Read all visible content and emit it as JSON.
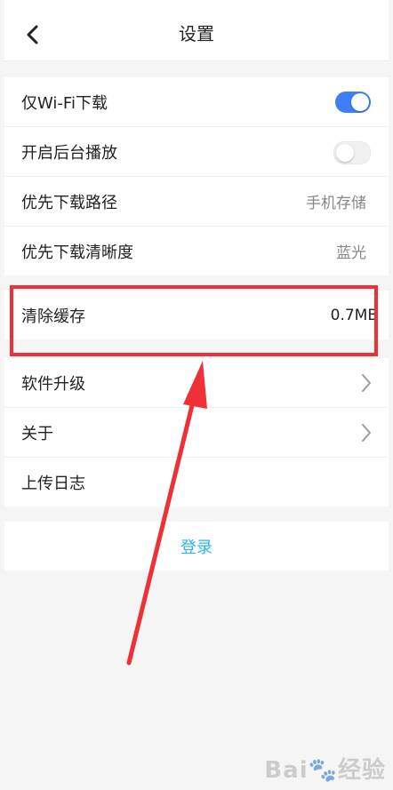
{
  "header": {
    "title": "设置"
  },
  "group1": {
    "items": [
      {
        "label": "仅Wi-Fi下载",
        "toggle": "on"
      },
      {
        "label": "开启后台播放",
        "toggle": "off"
      },
      {
        "label": "优先下载路径",
        "value": "手机存储"
      },
      {
        "label": "优先下载清晰度",
        "value": "蓝光"
      }
    ]
  },
  "group2": {
    "items": [
      {
        "label": "清除缓存",
        "value": "0.7MB"
      }
    ]
  },
  "group3": {
    "items": [
      {
        "label": "软件升级",
        "icon": "chevron-right-icon"
      },
      {
        "label": "关于",
        "icon": "chevron-right-icon"
      },
      {
        "label": "上传日志"
      }
    ]
  },
  "login": {
    "label": "登录"
  },
  "watermark": {
    "brand": "Bai",
    "suffix": "经验"
  },
  "colors": {
    "accent": "#3f7ef6",
    "login": "#2db6e8",
    "annotation": "#ee3136"
  }
}
